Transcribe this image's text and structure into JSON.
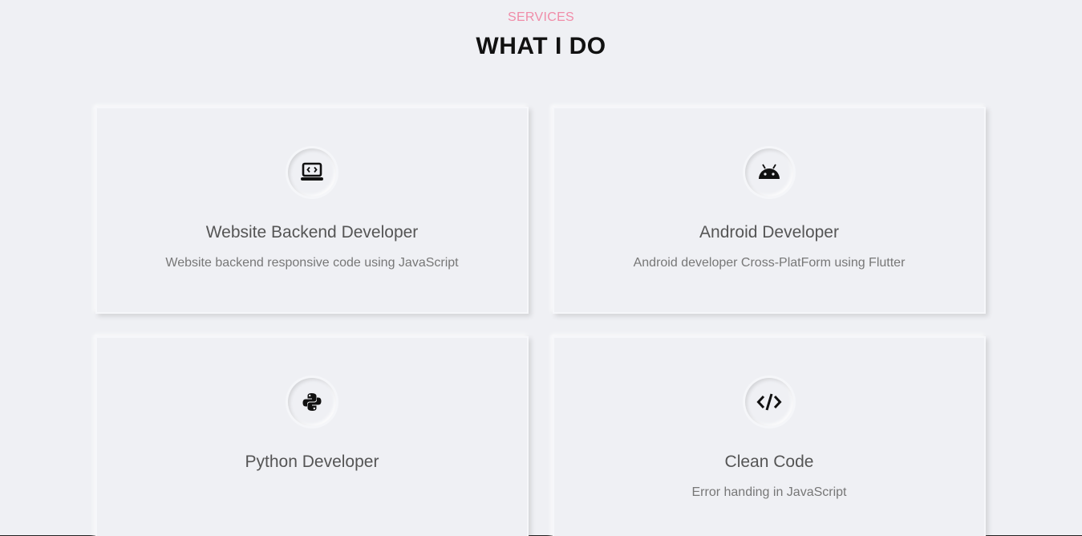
{
  "header": {
    "eyebrow": "SERVICES",
    "title": "WHAT I DO"
  },
  "colors": {
    "background": "#eff0f4",
    "accent": "#f08ca8"
  },
  "services": [
    {
      "icon": "laptop-code-icon",
      "title": "Website Backend Developer",
      "description": "Website backend responsive code using JavaScript"
    },
    {
      "icon": "android-icon",
      "title": "Android Developer",
      "description": "Android developer Cross-PlatForm using Flutter"
    },
    {
      "icon": "python-icon",
      "title": "Python Developer",
      "description": ""
    },
    {
      "icon": "code-icon",
      "title": "Clean Code",
      "description": "Error handing in JavaScript"
    }
  ]
}
